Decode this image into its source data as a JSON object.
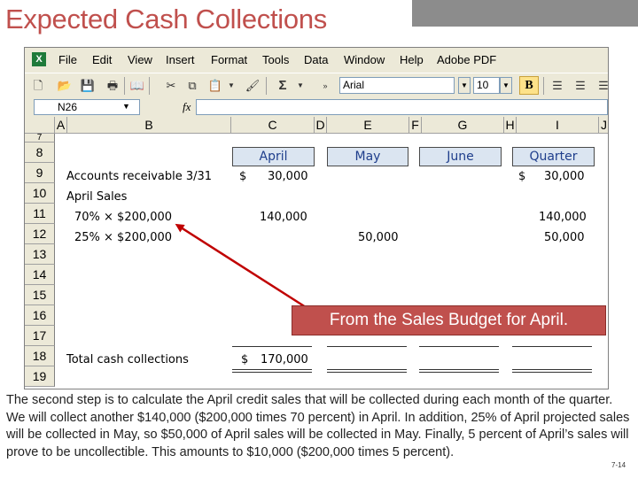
{
  "slide": {
    "title": "Expected Cash Collections",
    "callout": "From the Sales Budget for April.",
    "paragraph": "The second step is to calculate the April credit sales that will be collected during each month of the quarter. We will collect another $140,000 ($200,000 times 70 percent) in April. In addition, 25% of April projected sales will be collected in May, so $50,000 of April sales will be collected in May. Finally, 5 percent of April’s sales will prove to be uncollectible. This amounts to $10,000 ($200,000 times 5 percent).",
    "page_number": "7-14",
    "accent_color": "#c0504d"
  },
  "excel": {
    "menu": [
      "File",
      "Edit",
      "View",
      "Insert",
      "Format",
      "Tools",
      "Data",
      "Window",
      "Help",
      "Adobe PDF"
    ],
    "toolbar": {
      "font_name": "Arial",
      "font_size": "10",
      "bold_label": "B",
      "sigma": "Σ"
    },
    "name_box": "N26",
    "fx_label": "fx",
    "columns": [
      "A",
      "B",
      "C",
      "D",
      "E",
      "F",
      "G",
      "H",
      "I",
      "J"
    ],
    "rows": [
      "7",
      "8",
      "9",
      "10",
      "11",
      "12",
      "13",
      "14",
      "15",
      "16",
      "17",
      "18",
      "19"
    ],
    "headers": {
      "april": "April",
      "may": "May",
      "june": "June",
      "quarter": "Quarter"
    },
    "cells": {
      "r9_label": "Accounts receivable 3/31",
      "r9_dollar_c": "$",
      "r9_april": "30,000",
      "r9_dollar_i": "$",
      "r9_quarter": "30,000",
      "r10_label": "April Sales",
      "r11_label": "70% × $200,000",
      "r11_april": "140,000",
      "r11_quarter": "140,000",
      "r12_label": "25% × $200,000",
      "r12_may": "50,000",
      "r12_quarter": "50,000",
      "r18_label": "Total cash collections",
      "r18_dollar": "$",
      "r18_april": "170,000"
    }
  }
}
